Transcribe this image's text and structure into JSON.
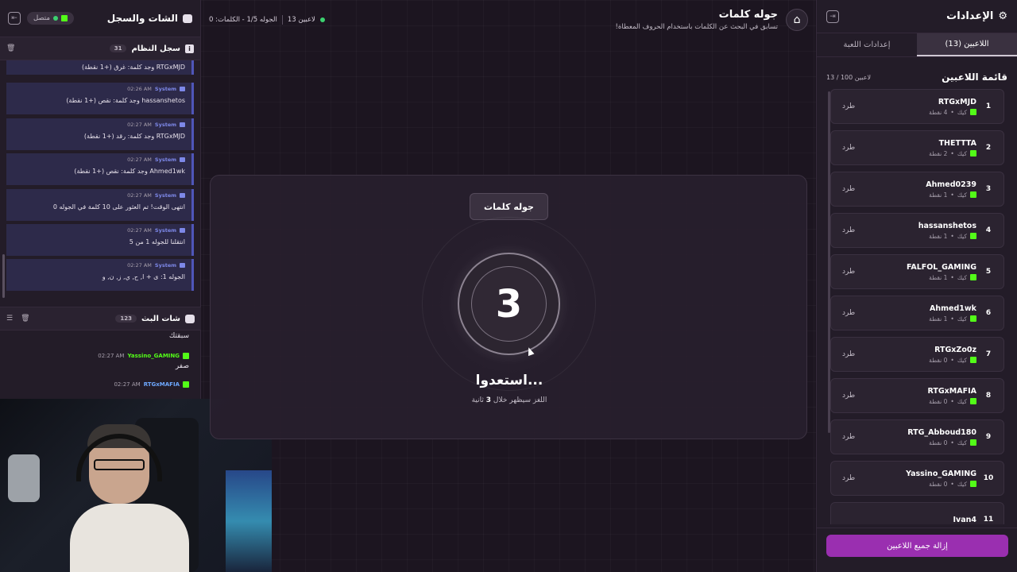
{
  "settings": {
    "title": "الإعدادات",
    "tabs": [
      {
        "label": "اللاعبين (13)",
        "active": true
      },
      {
        "label": "إعدادات اللعبة",
        "active": false
      }
    ],
    "list_title": "قائمة اللاعبين",
    "list_count": "13 / 100 لاعبين",
    "kick_label": "طرد",
    "platform": "كيك",
    "players": [
      {
        "num": "1",
        "name": "RTGxMJD",
        "points": "4 نقطة"
      },
      {
        "num": "2",
        "name": "THETTTA",
        "points": "2 نقطة"
      },
      {
        "num": "3",
        "name": "Ahmed0239",
        "points": "1 نقطة"
      },
      {
        "num": "4",
        "name": "hassanshetos",
        "points": "1 نقطة"
      },
      {
        "num": "5",
        "name": "FALFOL_GAMING",
        "points": "1 نقطة"
      },
      {
        "num": "6",
        "name": "Ahmed1wk",
        "points": "1 نقطة"
      },
      {
        "num": "7",
        "name": "RTGxZo0z",
        "points": "0 نقطة"
      },
      {
        "num": "8",
        "name": "RTGxMAFIA",
        "points": "0 نقطة"
      },
      {
        "num": "9",
        "name": "RTG_Abboud180",
        "points": "0 نقطة"
      },
      {
        "num": "10",
        "name": "Yassino_GAMING",
        "points": "0 نقطة"
      },
      {
        "num": "11",
        "name": "Ivan4",
        "points": ""
      }
    ],
    "remove_all": "إزالة جميع اللاعبين",
    "accent": "#9a2fb0"
  },
  "topbar": {
    "title": "جوله كلمات",
    "subtitle": "تسابق في البحث عن الكلمات باستخدام الحروف المعطاة!",
    "players_count": "13 لاعبين",
    "round_info": "الجوله 1/5 - الكلمات: 0"
  },
  "stage": {
    "badge": "جوله كلمات",
    "countdown": "3",
    "ready": "استعدوا...",
    "hint_prefix": "اللغز سيظهر خلال",
    "hint_num": "3",
    "hint_suffix": "ثانية"
  },
  "chat": {
    "title": "الشات والسجل",
    "status": "متصل",
    "syslog_title": "سجل النظام",
    "syslog_count": "31",
    "sys_name": "System",
    "logs": [
      {
        "time": "",
        "text": "RTGxMJD وجد كلمة: غرق (+1 نقطة)"
      },
      {
        "time": "02:26 AM",
        "text": "hassanshetos وجد كلمة: نقص (+1 نقطة)"
      },
      {
        "time": "02:27 AM",
        "text": "RTGxMJD وجد كلمة: رقد (+1 نقطة)"
      },
      {
        "time": "02:27 AM",
        "text": "Ahmed1wk وجد كلمة: نقص (+1 نقطة)"
      },
      {
        "time": "02:27 AM",
        "text": "انتهى الوقت! تم العثور على 10 كلمة في الجوله 0"
      },
      {
        "time": "02:27 AM",
        "text": "انتقلنا للجوله 1 من 5"
      },
      {
        "time": "02:27 AM",
        "text": "الجوله 1: ى + ا, ح, ي, ز, ن, و"
      }
    ],
    "stream_title": "شات البث",
    "stream_count": "123",
    "messages": [
      {
        "user": "",
        "time": "",
        "text": "سبقتك"
      },
      {
        "user": "Yassino_GAMING",
        "time": "02:27 AM",
        "text": "صفر"
      },
      {
        "user": "RTGxMAFIA",
        "time": "02:27 AM",
        "text": ""
      }
    ]
  }
}
